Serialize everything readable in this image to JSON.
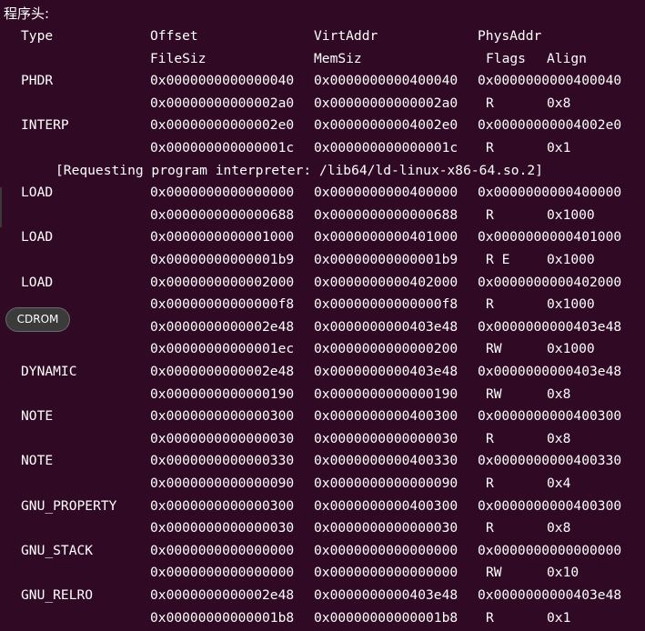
{
  "heading": "程序头:",
  "header": {
    "type": "Type",
    "offset": "Offset",
    "virtaddr": "VirtAddr",
    "physaddr": "PhysAddr",
    "filesiz": "FileSiz",
    "memsiz": "MemSiz",
    "flags": "Flags",
    "align": "Align"
  },
  "segments": [
    {
      "type": "PHDR",
      "offset": "0x0000000000000040",
      "virt": "0x0000000000400040",
      "phys": "0x0000000000400040",
      "filesiz": "0x00000000000002a0",
      "memsiz": "0x00000000000002a0",
      "flags": "R",
      "align": "0x8"
    },
    {
      "type": "INTERP",
      "offset": "0x00000000000002e0",
      "virt": "0x00000000004002e0",
      "phys": "0x00000000004002e0",
      "filesiz": "0x000000000000001c",
      "memsiz": "0x000000000000001c",
      "flags": "R",
      "align": "0x1"
    },
    {
      "type": "LOAD",
      "offset": "0x0000000000000000",
      "virt": "0x0000000000400000",
      "phys": "0x0000000000400000",
      "filesiz": "0x0000000000000688",
      "memsiz": "0x0000000000000688",
      "flags": "R",
      "align": "0x1000"
    },
    {
      "type": "LOAD",
      "offset": "0x0000000000001000",
      "virt": "0x0000000000401000",
      "phys": "0x0000000000401000",
      "filesiz": "0x00000000000001b9",
      "memsiz": "0x00000000000001b9",
      "flags": "R E",
      "align": "0x1000"
    },
    {
      "type": "LOAD",
      "offset": "0x0000000000002000",
      "virt": "0x0000000000402000",
      "phys": "0x0000000000402000",
      "filesiz": "0x00000000000000f8",
      "memsiz": "0x00000000000000f8",
      "flags": "R",
      "align": "0x1000"
    },
    {
      "type": "",
      "offset": "0x0000000000002e48",
      "virt": "0x0000000000403e48",
      "phys": "0x0000000000403e48",
      "filesiz": "0x00000000000001ec",
      "memsiz": "0x0000000000000200",
      "flags": "RW",
      "align": "0x1000"
    },
    {
      "type": "DYNAMIC",
      "offset": "0x0000000000002e48",
      "virt": "0x0000000000403e48",
      "phys": "0x0000000000403e48",
      "filesiz": "0x0000000000000190",
      "memsiz": "0x0000000000000190",
      "flags": "RW",
      "align": "0x8"
    },
    {
      "type": "NOTE",
      "offset": "0x0000000000000300",
      "virt": "0x0000000000400300",
      "phys": "0x0000000000400300",
      "filesiz": "0x0000000000000030",
      "memsiz": "0x0000000000000030",
      "flags": "R",
      "align": "0x8"
    },
    {
      "type": "NOTE",
      "offset": "0x0000000000000330",
      "virt": "0x0000000000400330",
      "phys": "0x0000000000400330",
      "filesiz": "0x0000000000000090",
      "memsiz": "0x0000000000000090",
      "flags": "R",
      "align": "0x4"
    },
    {
      "type": "GNU_PROPERTY",
      "offset": "0x0000000000000300",
      "virt": "0x0000000000400300",
      "phys": "0x0000000000400300",
      "filesiz": "0x0000000000000030",
      "memsiz": "0x0000000000000030",
      "flags": "R",
      "align": "0x8"
    },
    {
      "type": "GNU_STACK",
      "offset": "0x0000000000000000",
      "virt": "0x0000000000000000",
      "phys": "0x0000000000000000",
      "filesiz": "0x0000000000000000",
      "memsiz": "0x0000000000000000",
      "flags": "RW",
      "align": "0x10"
    },
    {
      "type": "GNU_RELRO",
      "offset": "0x0000000000002e48",
      "virt": "0x0000000000403e48",
      "phys": "0x0000000000403e48",
      "filesiz": "0x00000000000001b8",
      "memsiz": "0x00000000000001b8",
      "flags": "R",
      "align": "0x1"
    }
  ],
  "interp_note": "[Requesting program interpreter: /lib64/ld-linux-x86-64.so.2]",
  "overlay_button": "CDROM"
}
